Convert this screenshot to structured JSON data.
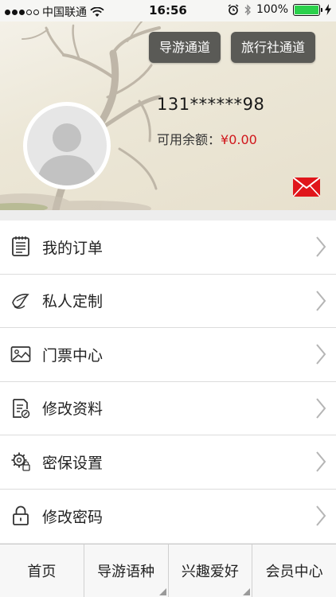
{
  "status_bar": {
    "carrier": "中国联通",
    "time": "16:56",
    "battery": "100%",
    "battery_level": 1.0,
    "signal_bars_filled": 3,
    "signal_bars_total": 5
  },
  "header": {
    "guide_channel_label": "导游通道",
    "agency_channel_label": "旅行社通道",
    "user_name": "131******98",
    "balance_label": "可用余额：",
    "balance_value": "¥0.00",
    "colors": {
      "balance": "#d0161b",
      "mail": "#e0161b",
      "button_bg": "#5a5a56"
    }
  },
  "menu": {
    "items": [
      {
        "label": "我的订单",
        "icon": "order-list-icon"
      },
      {
        "label": "私人定制",
        "icon": "custom-icon"
      },
      {
        "label": "门票中心",
        "icon": "ticket-image-icon"
      },
      {
        "label": "修改资料",
        "icon": "edit-profile-icon"
      },
      {
        "label": "密保设置",
        "icon": "security-settings-icon"
      },
      {
        "label": "修改密码",
        "icon": "lock-icon"
      }
    ]
  },
  "tabbar": {
    "tabs": [
      {
        "label": "首页"
      },
      {
        "label": "导游语种"
      },
      {
        "label": "兴趣爱好"
      },
      {
        "label": "会员中心"
      }
    ]
  }
}
